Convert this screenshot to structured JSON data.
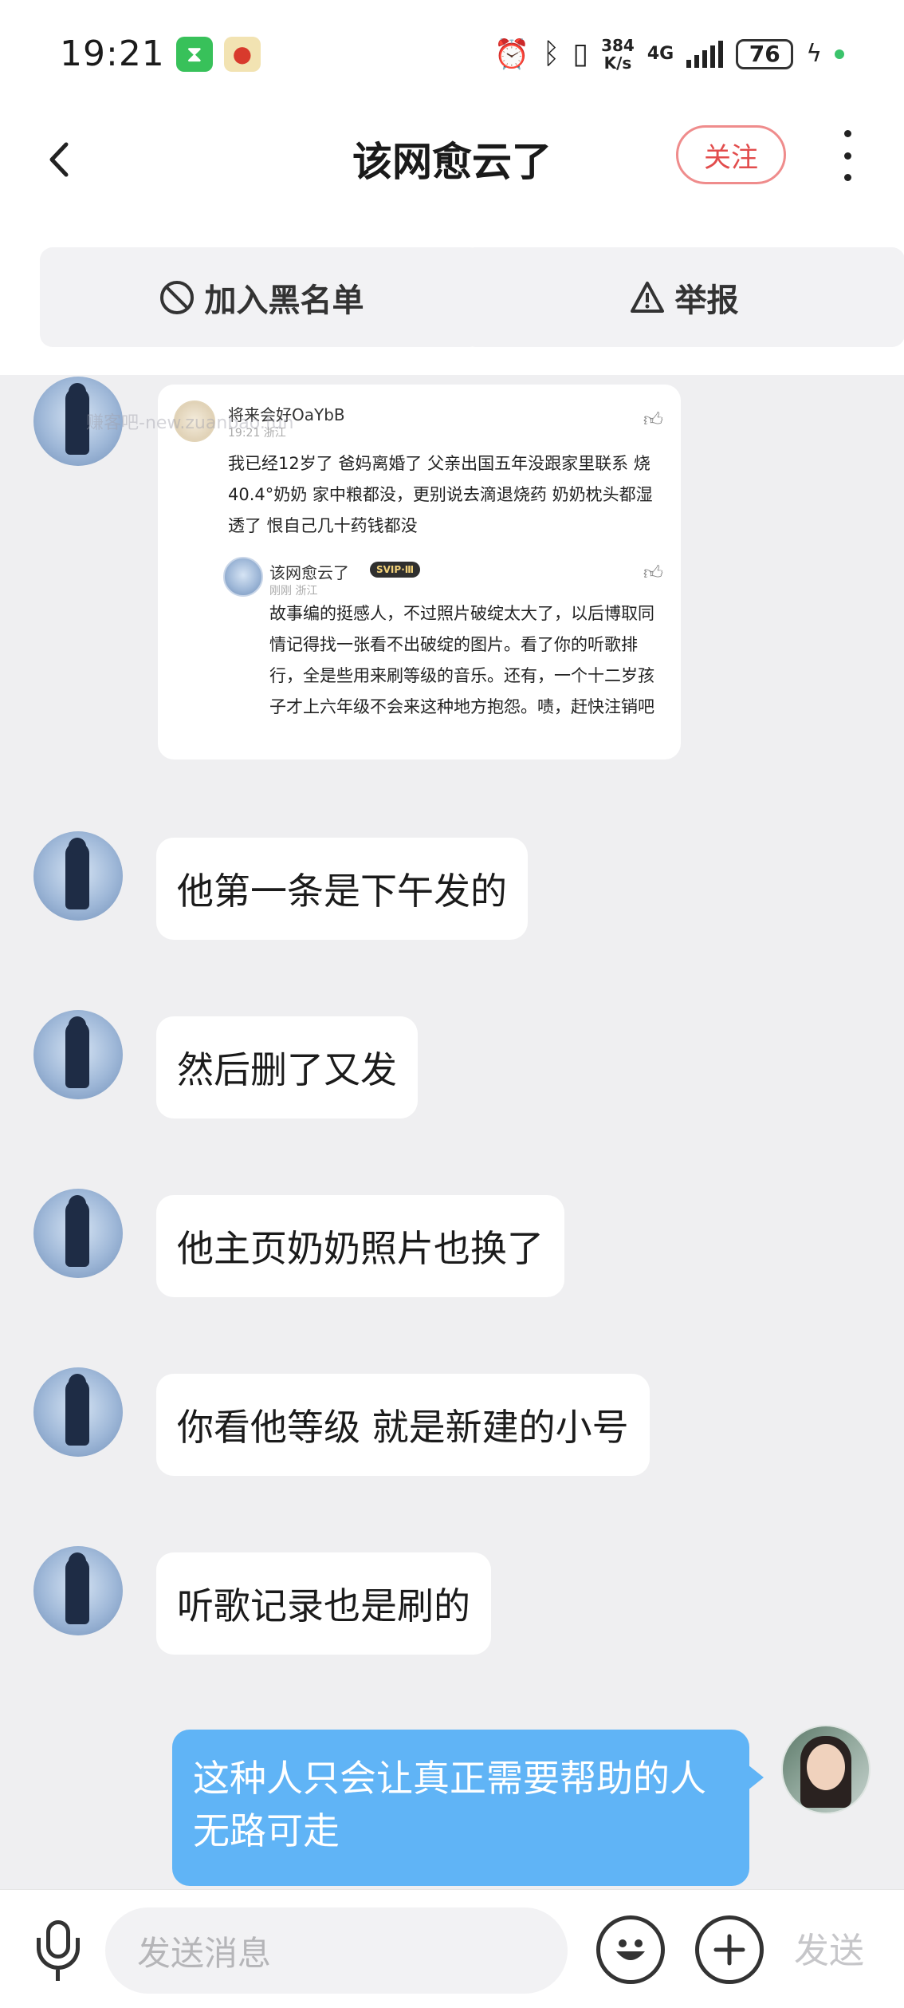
{
  "status_bar": {
    "time": "19:21",
    "net_speed_top": "384",
    "net_speed_bottom": "K/s",
    "network": "4G",
    "battery": "76",
    "app_icons": [
      "hourglass-icon",
      "tomato-icon"
    ]
  },
  "nav": {
    "title": "该网愈云了",
    "follow_label": "关注"
  },
  "actions": {
    "blacklist_label": "加入黑名单",
    "report_label": "举报"
  },
  "shared_card": {
    "author": "将来会好OaYbB",
    "author_meta": "19:21 浙江",
    "comment": "我已经12岁了 爸妈离婚了 父亲出国五年没跟家里联系 烧40.4°奶奶 家中粮都没，更别说去滴退烧药 奶奶枕头都湿透了 恨自己几十药钱都没",
    "reply_author": "该网愈云了",
    "reply_badge": "SVIP·Ⅲ",
    "reply_meta": "刚刚 浙江",
    "reply": "故事编的挺感人，不过照片破绽太大了，以后博取同情记得找一张看不出破绽的图片。看了你的听歌排行，全是些用来刷等级的音乐。还有，一个十二岁孩子才上六年级不会来这种地方抱怨。啧，赶快注销吧"
  },
  "messages": [
    {
      "text": "他第一条是下午发的"
    },
    {
      "text": "然后删了又发"
    },
    {
      "text": "他主页奶奶照片也换了"
    },
    {
      "text": "你看他等级 就是新建的小号"
    },
    {
      "text": "听歌记录也是刷的"
    }
  ],
  "my_message": {
    "text": "这种人只会让真正需要帮助的人无路可走"
  },
  "input": {
    "placeholder": "发送消息",
    "send_label": "发送"
  },
  "watermark": "赚客吧-new.zuanbao.fun"
}
